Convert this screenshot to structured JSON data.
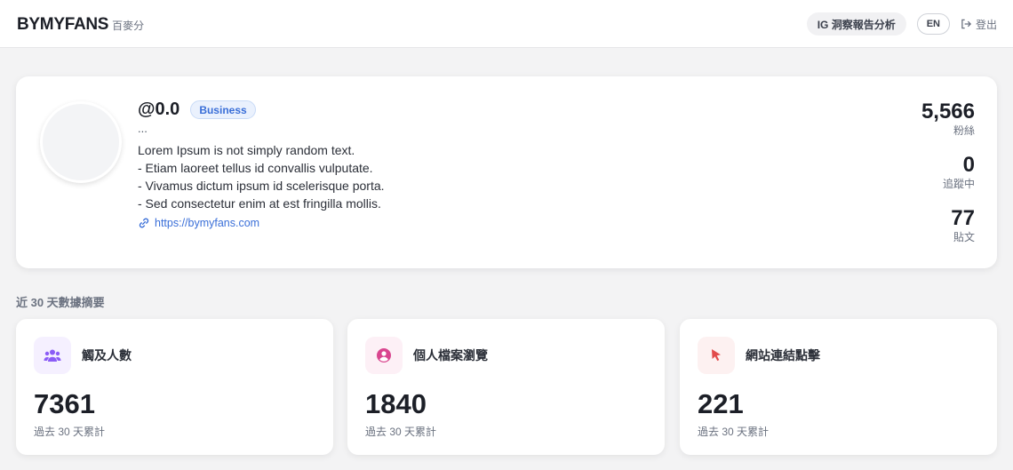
{
  "header": {
    "brand": "BYMYFANS",
    "brand_sub": "百麥分",
    "ig_button": "IG 洞察報告分析",
    "lang_button": "EN",
    "logout": "登出"
  },
  "profile": {
    "handle": "@0.0",
    "badge": "Business",
    "full_name": "...",
    "bio": [
      "Lorem Ipsum is not simply random text.",
      "- Etiam laoreet tellus id convallis vulputate.",
      "- Vivamus dictum ipsum id scelerisque porta.",
      "- Sed consectetur enim at est fringilla mollis."
    ],
    "website": "https://bymyfans.com",
    "stats": [
      {
        "value": "5,566",
        "label": "粉絲"
      },
      {
        "value": "0",
        "label": "追蹤中"
      },
      {
        "value": "77",
        "label": "貼文"
      }
    ]
  },
  "summary": {
    "title": "近 30 天數據摘要",
    "cards": [
      {
        "icon": "users-icon",
        "title": "觸及人數",
        "value": "7361",
        "sub": "過去 30 天累計",
        "icon_color": "#8b5cf6",
        "icon_bg": "#f5f0ff"
      },
      {
        "icon": "user-circle-icon",
        "title": "個人檔案瀏覽",
        "value": "1840",
        "sub": "過去 30 天累計",
        "icon_color": "#d9468f",
        "icon_bg": "#fdf0f6"
      },
      {
        "icon": "cursor-icon",
        "title": "網站連結點擊",
        "value": "221",
        "sub": "過去 30 天累計",
        "icon_color": "#e24a4a",
        "icon_bg": "#fdf1f1"
      }
    ]
  }
}
